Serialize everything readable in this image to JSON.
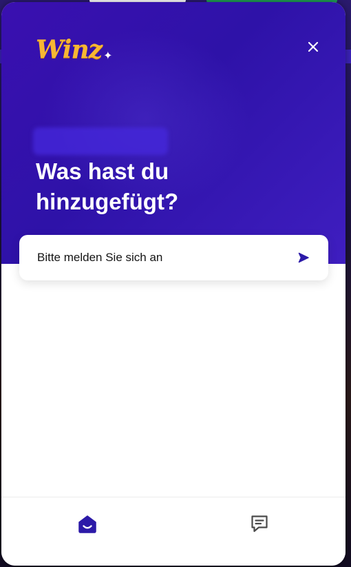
{
  "widget": {
    "logo_text": "Winz",
    "logo_sparkle": "✦",
    "headline_line1": "Was hast du",
    "headline_line2": "hinzugefügt?",
    "signin_label": "Bitte melden Sie sich an"
  },
  "bottom_nav": {
    "tabs": [
      {
        "icon": "home-icon",
        "active": true
      },
      {
        "icon": "messages-icon",
        "active": false
      }
    ]
  },
  "colors": {
    "hero_background": "#3a10b0",
    "accent": "#3b22b8",
    "logo": "#f7b733",
    "send_icon": "#2c1aa8",
    "inactive_icon": "#4a4a4a"
  }
}
